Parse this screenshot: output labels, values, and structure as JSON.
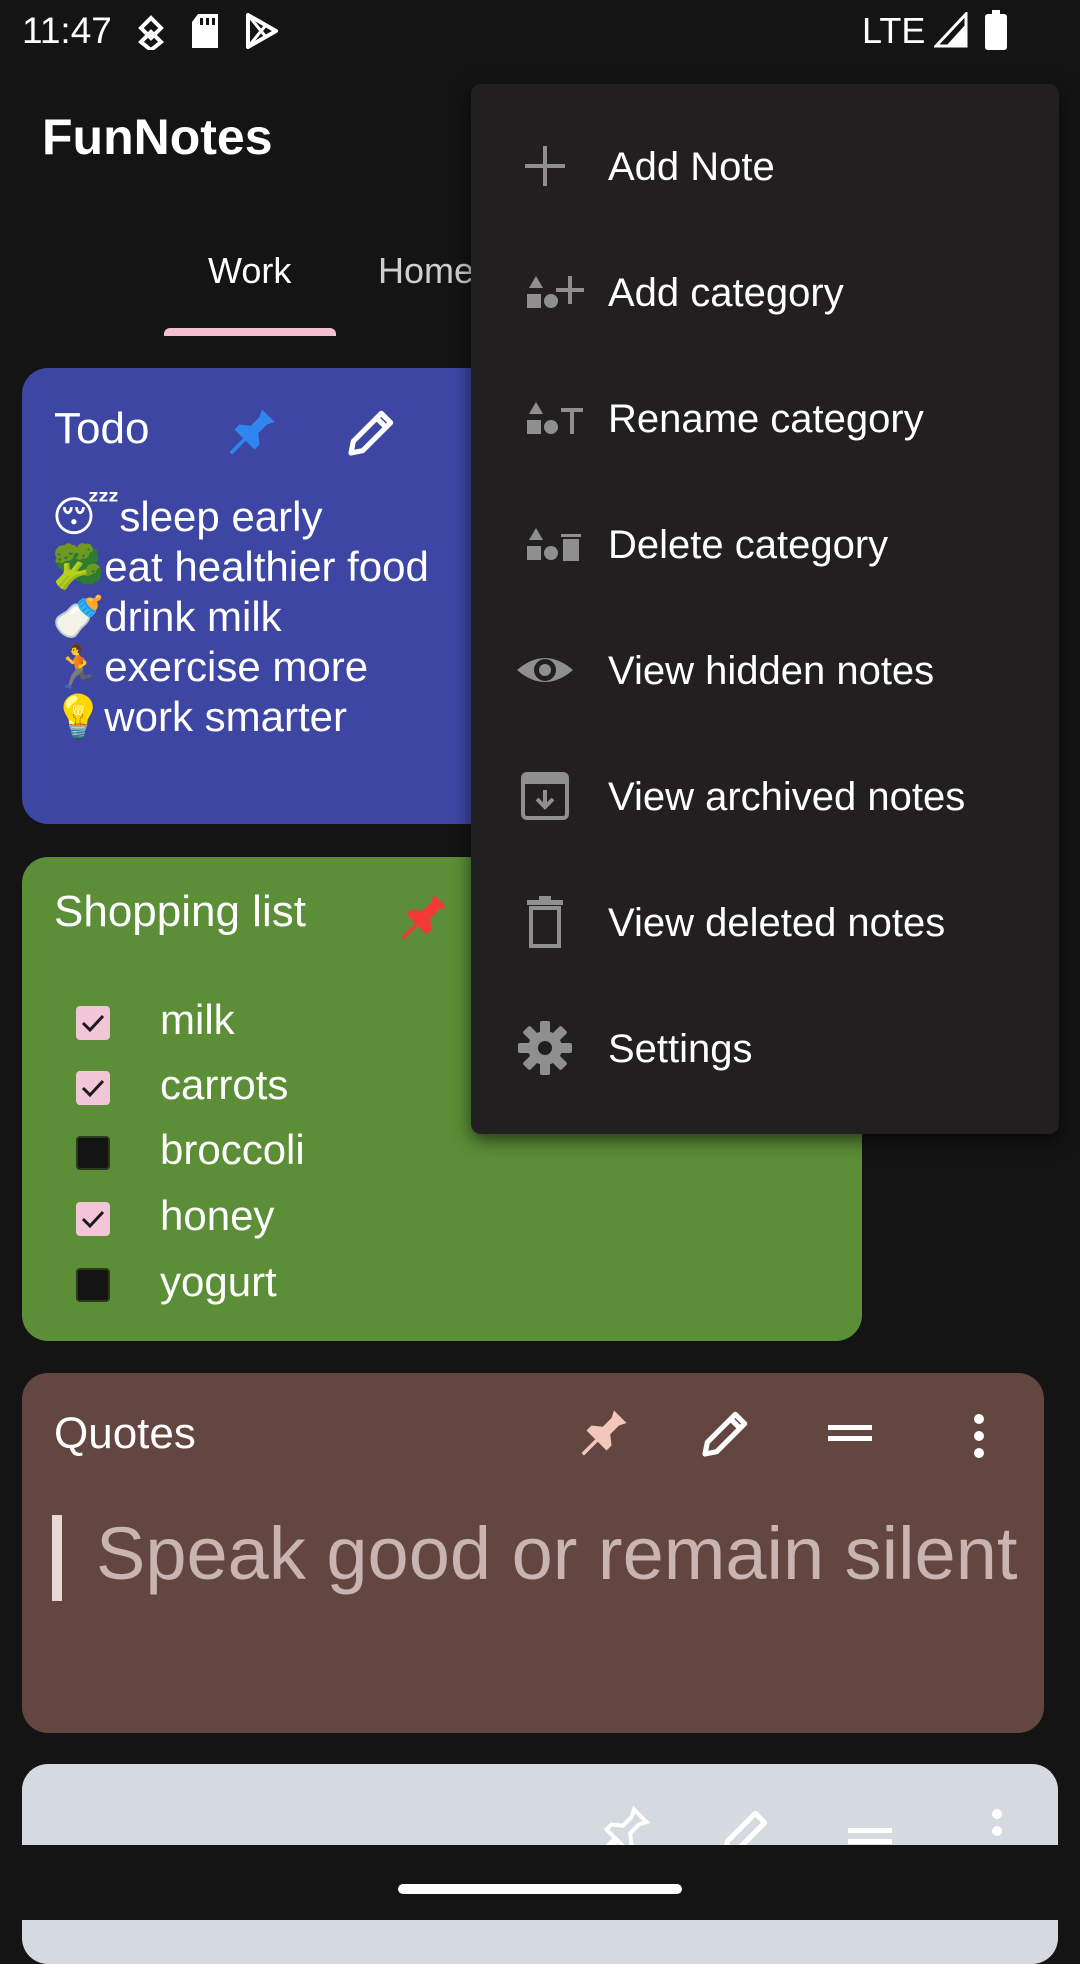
{
  "status_bar": {
    "time": "11:47",
    "network": "LTE"
  },
  "app": {
    "title": "FunNotes"
  },
  "tabs": [
    {
      "label": "Work",
      "selected": true
    },
    {
      "label": "Home",
      "selected": false
    }
  ],
  "notes": {
    "todo": {
      "title": "Todo",
      "lines": [
        "😴sleep early",
        "🥦eat healthier food",
        "🍼drink milk",
        "🏃exercise more",
        "💡work smarter"
      ],
      "color": "#3e46a4"
    },
    "shopping": {
      "title": "Shopping list",
      "items": [
        {
          "label": "milk",
          "checked": true
        },
        {
          "label": "carrots",
          "checked": true
        },
        {
          "label": "broccoli",
          "checked": false
        },
        {
          "label": "honey",
          "checked": true
        },
        {
          "label": "yogurt",
          "checked": false
        }
      ],
      "color": "#5b8e37"
    },
    "quotes": {
      "title": "Quotes",
      "quote": "Speak good or remain silent",
      "color": "#634640"
    },
    "lorem": {
      "color": "#d5dae0"
    }
  },
  "menu": {
    "items": [
      {
        "label": "Add Note",
        "icon": "plus-icon"
      },
      {
        "label": "Add category",
        "icon": "add-category-icon"
      },
      {
        "label": "Rename category",
        "icon": "rename-category-icon"
      },
      {
        "label": "Delete category",
        "icon": "delete-category-icon"
      },
      {
        "label": "View hidden notes",
        "icon": "eye-icon"
      },
      {
        "label": "View archived notes",
        "icon": "archive-icon"
      },
      {
        "label": "View deleted notes",
        "icon": "trash-icon"
      },
      {
        "label": "Settings",
        "icon": "gear-icon"
      }
    ]
  }
}
